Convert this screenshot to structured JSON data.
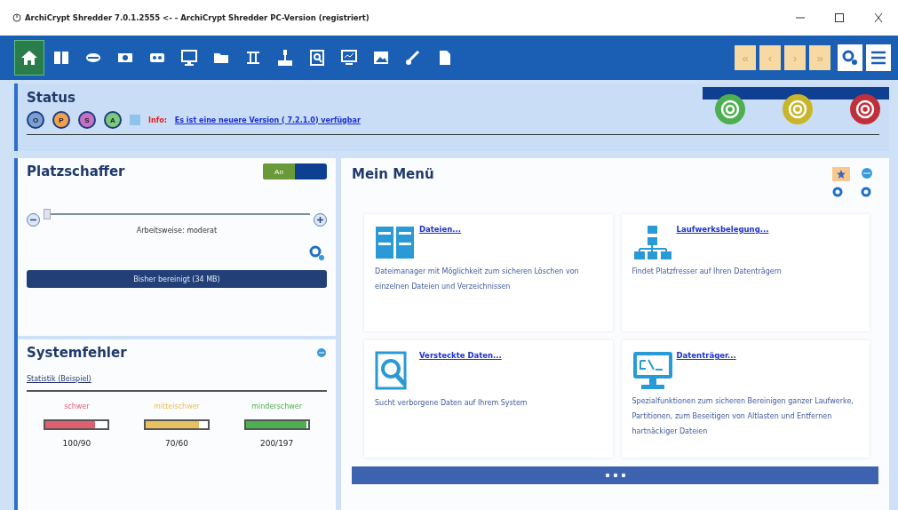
{
  "window": {
    "title": "ArchiCrypt Shredder 7.0.1.2555 <-  - ArchiCrypt Shredder PC-Version (registriert)"
  },
  "toolbar": {
    "tools": [
      {
        "selected": true
      },
      {
        "selected": false
      },
      {
        "selected": false
      },
      {
        "selected": false
      },
      {
        "selected": false
      },
      {
        "selected": false
      },
      {
        "selected": false
      },
      {
        "selected": false
      },
      {
        "selected": false
      },
      {
        "selected": false
      },
      {
        "selected": false
      },
      {
        "selected": false
      },
      {
        "selected": false
      },
      {
        "selected": false
      }
    ],
    "nav": [
      {
        "label": "«",
        "disabled": true
      },
      {
        "label": "‹",
        "disabled": true
      },
      {
        "label": "›",
        "disabled": true
      },
      {
        "label": "»",
        "disabled": true
      }
    ]
  },
  "status": {
    "title": "Status",
    "modes": [
      {
        "label": "O",
        "color": "#7d9fd8"
      },
      {
        "label": "P",
        "color": "#f0a050"
      },
      {
        "label": "S",
        "color": "#c870c8"
      },
      {
        "label": "A",
        "color": "#7cc87c"
      }
    ],
    "info_label": "Info:",
    "info_link": "Es ist eine neuere Version ( 7.2.1.0) verfügbar",
    "targets": [
      {
        "color": "#4caf50"
      },
      {
        "color": "#c9b52a"
      },
      {
        "color": "#c0303a"
      }
    ]
  },
  "platzschaffer": {
    "title": "Platzschaffer",
    "toggle": {
      "label": "An",
      "on": true
    },
    "slider": {
      "level": 0.0
    },
    "mode_label": "Arbeitsweise: moderat",
    "button": "Bisher bereinigt (34 MB)"
  },
  "systemfehler": {
    "title": "Systemfehler",
    "link": "Statistik (Beispiel)",
    "meters": [
      {
        "label": "schwer",
        "color": "#e06070",
        "level": 0.8,
        "reading": "100/90"
      },
      {
        "label": "mittelschwer",
        "color": "#e8c060",
        "level": 0.86,
        "reading": "70/60"
      },
      {
        "label": "minderschwer",
        "color": "#4caf50",
        "level": 0.98,
        "reading": "200/197"
      }
    ]
  },
  "menu": {
    "title": "Mein Menü",
    "cards": [
      {
        "kind": "files",
        "title": "Dateien...",
        "description": "Dateimanager mit Möglichkeit zum sicheren Löschen von einzelnen Dateien und Verzeichnissen"
      },
      {
        "kind": "drives",
        "title": "Laufwerksbelegung...",
        "description": "Findet Platzfresser auf Ihren Datenträgern"
      },
      {
        "kind": "search",
        "title": "Versteckte  Daten...",
        "description": "Sucht verborgene Daten auf Ihrem System"
      },
      {
        "kind": "console",
        "title": "Datenträger...",
        "description": "Spezialfunktionen zum sicheren Bereinigen ganzer Laufwerke, Partitionen, zum Beseitigen von Altlasten und Entfernen hartnäckiger Dateien"
      }
    ]
  }
}
